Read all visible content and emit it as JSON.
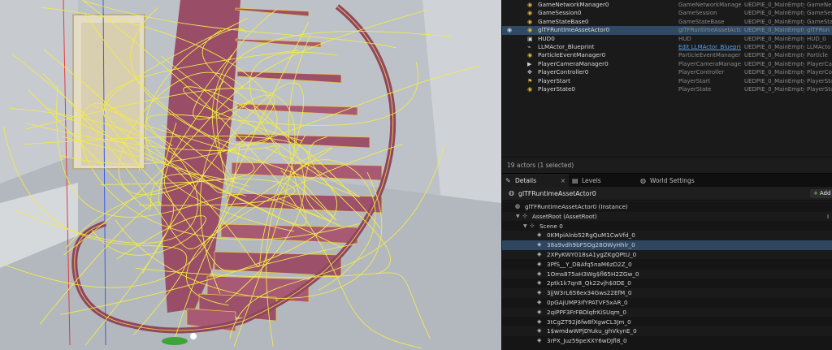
{
  "outliner": {
    "rows": [
      {
        "icon": "component-icon",
        "name": "GameNetworkManager0",
        "type": "GameNetworkManager",
        "level": "UEDPIE_0_MainEmpty",
        "label": "GameNet",
        "selected": false
      },
      {
        "icon": "component-icon",
        "name": "GameSession0",
        "type": "GameSession",
        "level": "UEDPIE_0_MainEmpty",
        "label": "GameSes",
        "selected": false
      },
      {
        "icon": "component-icon",
        "name": "GameStateBase0",
        "type": "GameStateBase",
        "level": "UEDPIE_0_MainEmpty",
        "label": "GameSta",
        "selected": false
      },
      {
        "icon": "component-icon",
        "name": "glTFRuntimeAssetActor0",
        "type": "glTFRuntimeAssetActor",
        "level": "UEDPIE_0_MainEmpty",
        "label": "glTFRun",
        "selected": true
      },
      {
        "icon": "hud-icon",
        "name": "HUD0",
        "type": "HUD",
        "level": "UEDPIE_0_MainEmpty",
        "label": "HUD_0",
        "selected": false
      },
      {
        "icon": "blueprint-icon",
        "name": "LLMActor_Blueprint",
        "type": "Edit LLMActor_Blueprint",
        "level": "UEDPIE_0_MainEmpty",
        "label": "LLMActo",
        "selected": false,
        "link": true
      },
      {
        "icon": "component-icon",
        "name": "ParticleEventManager0",
        "type": "ParticleEventManager",
        "level": "UEDPIE_0_MainEmpty",
        "label": "Particle",
        "selected": false
      },
      {
        "icon": "camera-icon",
        "name": "PlayerCameraManager0",
        "type": "PlayerCameraManager",
        "level": "UEDPIE_0_MainEmpty",
        "label": "PlayerCa",
        "selected": false
      },
      {
        "icon": "gamepad-icon",
        "name": "PlayerController0",
        "type": "PlayerController",
        "level": "UEDPIE_0_MainEmpty",
        "label": "PlayerCo",
        "selected": false
      },
      {
        "icon": "flag-icon",
        "name": "PlayerStart",
        "type": "PlayerStart",
        "level": "UEDPIE_0_MainEmpty",
        "label": "PlayerSta",
        "selected": false
      },
      {
        "icon": "component-icon",
        "name": "PlayerState0",
        "type": "PlayerState",
        "level": "UEDPIE_0_MainEmpty",
        "label": "PlayerSta",
        "selected": false
      }
    ]
  },
  "status": {
    "text": "19 actors (1 selected)"
  },
  "tabs": [
    {
      "label": "Details",
      "icon": "details-icon",
      "active": true,
      "closable": true
    },
    {
      "label": "Levels",
      "icon": "levels-icon",
      "active": false,
      "closable": false
    },
    {
      "label": "World Settings",
      "icon": "globe-icon",
      "active": false,
      "closable": false
    }
  ],
  "details": {
    "actor_name": "glTFRuntimeAssetActor0",
    "add_label": "Add"
  },
  "tree": {
    "rows": [
      {
        "label": "glTFRuntimeAssetActor0 (Instance)",
        "indent": 0,
        "arrow": false,
        "icon": "actor-icon",
        "selected": false
      },
      {
        "label": "AssetRoot (AssetRoot)",
        "indent": 1,
        "arrow": true,
        "icon": "scene-root-icon",
        "selected": false,
        "tail": "I"
      },
      {
        "label": "Scene 0",
        "indent": 2,
        "arrow": true,
        "icon": "scene-icon",
        "selected": false
      },
      {
        "label": "0KMpiAlnb52RgQuM1CwVfd_0",
        "indent": 3,
        "arrow": false,
        "icon": "mesh-icon",
        "selected": false
      },
      {
        "label": "38a9vdh9bF5Og28OWyHhlr_0",
        "indent": 3,
        "arrow": false,
        "icon": "mesh-icon",
        "selected": true
      },
      {
        "label": "2XPyKWY018sA1ygZKgQPtU_0",
        "indent": 3,
        "arrow": false,
        "icon": "mesh-icon",
        "selected": false
      },
      {
        "label": "3PfS__Y_DBAfq5naM6zD2Z_0",
        "indent": 3,
        "arrow": false,
        "icon": "mesh-icon",
        "selected": false
      },
      {
        "label": "1Oms875aH3Wg$fl65H2ZGw_0",
        "indent": 3,
        "arrow": false,
        "icon": "mesh-icon",
        "selected": false
      },
      {
        "label": "2ptk1k7qn8_Qk22vjh$0DE_0",
        "indent": 3,
        "arrow": false,
        "icon": "mesh-icon",
        "selected": false
      },
      {
        "label": "3jjW3rL656ex34Gws22EfM_0",
        "indent": 3,
        "arrow": false,
        "icon": "mesh-icon",
        "selected": false
      },
      {
        "label": "0pGAjUMP3IfYPATVF5xAR_0",
        "indent": 3,
        "arrow": false,
        "icon": "mesh-icon",
        "selected": false
      },
      {
        "label": "2qiPPF3FrFBOlqfrKiSUqm_0",
        "indent": 3,
        "arrow": false,
        "icon": "mesh-icon",
        "selected": false
      },
      {
        "label": "3tCgZT92j6fw8fXgwCL3Jm_0",
        "indent": 3,
        "arrow": false,
        "icon": "mesh-icon",
        "selected": false
      },
      {
        "label": "1$wmdwWPjDYuku_ghVkynE_0",
        "indent": 3,
        "arrow": false,
        "icon": "mesh-icon",
        "selected": false
      },
      {
        "label": "3rPX_Juz59peXXY6wDJfl8_0",
        "indent": 3,
        "arrow": false,
        "icon": "mesh-icon",
        "selected": false
      }
    ]
  },
  "colors": {
    "stair": "#a0546e",
    "stair_outline": "#e8c24a",
    "wire": "#f2ea4a",
    "selection": "#2f4a66",
    "link": "#5aa0f0"
  }
}
